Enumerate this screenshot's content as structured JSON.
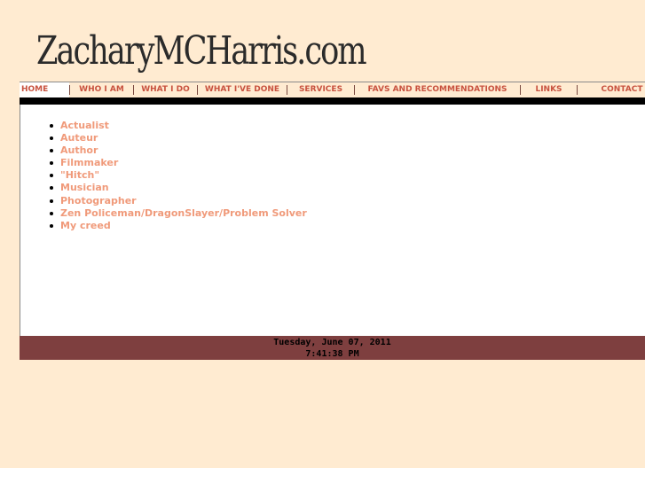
{
  "site": {
    "logo_text": "ZacharyMCHarris.com"
  },
  "nav": {
    "items": [
      {
        "label": "HOME",
        "active": true
      },
      {
        "label": "WHO I AM"
      },
      {
        "label": "WHAT I DO"
      },
      {
        "label": "WHAT I'VE DONE"
      },
      {
        "label": "SERVICES"
      },
      {
        "label": "FAVS AND RECOMMENDATIONS"
      },
      {
        "label": "LINKS"
      },
      {
        "label": "CONTACT"
      }
    ]
  },
  "menu": {
    "items": [
      "Actualist",
      "Auteur",
      "Author",
      "Filmmaker",
      "\"Hitch\"",
      "Musician",
      "Photographer",
      "Zen Policeman/DragonSlayer/Problem Solver",
      "My creed"
    ]
  },
  "footer": {
    "date": "Tuesday, June 07, 2011",
    "time": "7:41:38 PM"
  },
  "colors": {
    "page_background": "#ffebd1",
    "nav_text": "#c8523f",
    "link": "#f09a7a",
    "footer_background": "#7e3f3f"
  }
}
